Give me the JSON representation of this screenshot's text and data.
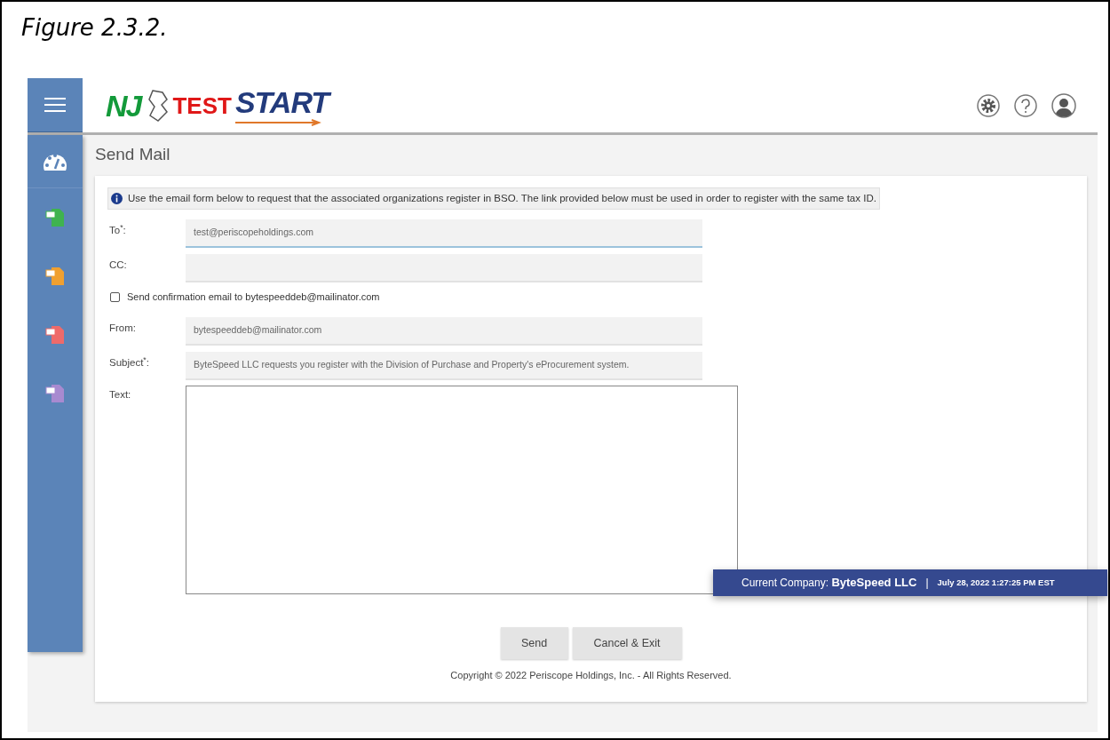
{
  "caption": "Figure 2.3.2.",
  "logo": {
    "left": "NJ",
    "overlay": "TEST",
    "right": "START"
  },
  "sidebar": {
    "items": [
      {
        "kind": "dashboard"
      },
      {
        "kind": "document",
        "color": "#3fb34f"
      },
      {
        "kind": "document",
        "color": "#f0a030"
      },
      {
        "kind": "document",
        "color": "#ee6a6a"
      },
      {
        "kind": "document",
        "color": "#a88ad0"
      }
    ]
  },
  "page_title": "Send Mail",
  "info": "Use the email form below to request that the associated organizations register in BSO. The link provided below must be used in order to register with the same tax ID.",
  "fields": [
    {
      "kind": "text",
      "label": "To$^{*}$:",
      "value": "test@periscopeholdings.com",
      "focused": true
    },
    {
      "kind": "text",
      "label": "CC:",
      "focused": false
    },
    {
      "kind": "checkbox",
      "label": "Send confirmation email to bytespeeddeb@mailinator.com",
      "checked": false
    },
    {
      "kind": "text",
      "label": "From:",
      "value": "bytespeeddeb@mailinator.com",
      "focused": false
    },
    {
      "kind": "text",
      "label": "Subject$^{*}$:",
      "value": "ByteSpeed LLC requests you register with the Division of Purchase and Property's eProcurement system.",
      "focused": false
    },
    {
      "kind": "textarea",
      "label": "Text:"
    }
  ],
  "buttons": [
    "Send",
    "Cancel & Exit"
  ],
  "copyright": "Copyright © 2022 Periscope Holdings, Inc. - All Rights Reserved.",
  "status_bar": {
    "label": "Current Company:",
    "company": "ByteSpeed LLC",
    "separator": "|",
    "datetime": "July 28, 2022 1:27:25 PM EST"
  }
}
